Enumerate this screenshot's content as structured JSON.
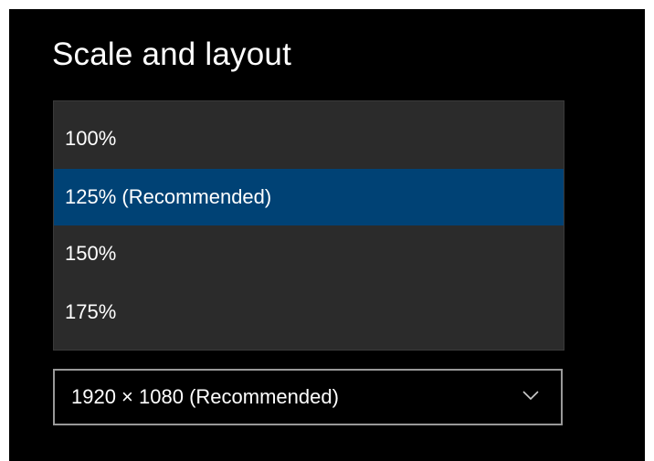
{
  "section": {
    "title": "Scale and layout"
  },
  "scale_dropdown": {
    "options": [
      {
        "label": "100%"
      },
      {
        "label": "125% (Recommended)",
        "selected": true
      },
      {
        "label": "150%"
      },
      {
        "label": "175%"
      }
    ]
  },
  "resolution": {
    "value": "1920 × 1080 (Recommended)",
    "icon": "chevron-down-icon"
  },
  "colors": {
    "background": "#000000",
    "dropdown_bg": "#2b2b2b",
    "selected_bg": "#004275",
    "text": "#ffffff",
    "border": "#999999"
  }
}
